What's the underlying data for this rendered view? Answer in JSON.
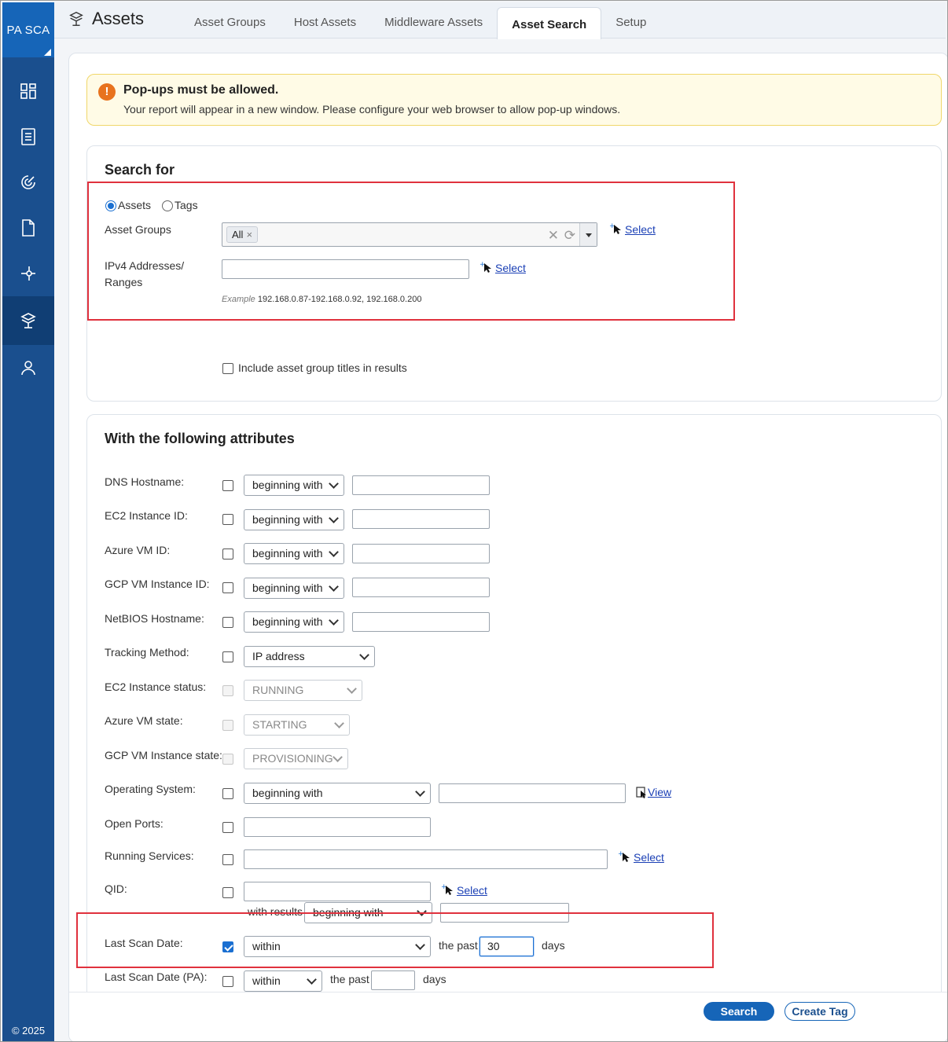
{
  "sidebar": {
    "brand": "PA SCA",
    "copyright": "© 2025",
    "items": [
      {
        "name": "dashboard-icon"
      },
      {
        "name": "report-icon"
      },
      {
        "name": "scan-icon"
      },
      {
        "name": "document-icon"
      },
      {
        "name": "connector-icon"
      },
      {
        "name": "assets-icon",
        "active": true
      },
      {
        "name": "user-icon"
      }
    ]
  },
  "header": {
    "title": "Assets",
    "tabs": [
      "Asset Groups",
      "Host Assets",
      "Middleware Assets",
      "Asset Search",
      "Setup"
    ],
    "active_tab": "Asset Search"
  },
  "alert": {
    "title": "Pop-ups must be allowed.",
    "text": "Your report will appear in a new window. Please configure your web browser to allow pop-up windows."
  },
  "search_for": {
    "title": "Search for",
    "radio_assets": "Assets",
    "radio_tags": "Tags",
    "selected": "Assets",
    "asset_groups_label": "Asset Groups",
    "asset_groups_tag": "All",
    "select_label": "Select",
    "ipv4_label_1": "IPv4 Addresses/",
    "ipv4_label_2": "Ranges",
    "ipv4_value": "",
    "example_prefix": "Example",
    "example_value": "192.168.0.87-192.168.0.92, 192.168.0.200",
    "include_titles": "Include asset group titles in results"
  },
  "attributes": {
    "title": "With the following attributes",
    "dns_hostname": {
      "label": "DNS Hostname:",
      "op": "beginning with"
    },
    "ec2_instance_id": {
      "label": "EC2 Instance ID:",
      "op": "beginning with"
    },
    "azure_vm_id": {
      "label": "Azure VM ID:",
      "op": "beginning with"
    },
    "gcp_vm_instance_id": {
      "label": "GCP VM Instance ID:",
      "op": "beginning with"
    },
    "netbios_hostname": {
      "label": "NetBIOS Hostname:",
      "op": "beginning with"
    },
    "tracking_method": {
      "label": "Tracking Method:",
      "op": "IP address"
    },
    "ec2_status": {
      "label": "EC2 Instance status:",
      "op": "RUNNING"
    },
    "azure_state": {
      "label": "Azure VM state:",
      "op": "STARTING"
    },
    "gcp_state": {
      "label": "GCP VM Instance state:",
      "op": "PROVISIONING"
    },
    "os": {
      "label": "Operating System:",
      "op": "beginning with",
      "view": "View"
    },
    "open_ports": {
      "label": "Open Ports:"
    },
    "running_services": {
      "label": "Running Services:",
      "select": "Select"
    },
    "qid": {
      "label": "QID:",
      "select": "Select",
      "with_results": "with results",
      "op": "beginning with"
    },
    "last_scan_date": {
      "label": "Last Scan Date:",
      "op": "within",
      "the_past": "the past",
      "value": "30",
      "unit": "days",
      "checked": true
    },
    "last_scan_date_pa": {
      "label": "Last Scan Date (PA):",
      "op": "within",
      "the_past": "the past",
      "value": "",
      "unit": "days"
    }
  },
  "footer": {
    "search_button": "Search",
    "create_tag_button": "Create Tag"
  }
}
